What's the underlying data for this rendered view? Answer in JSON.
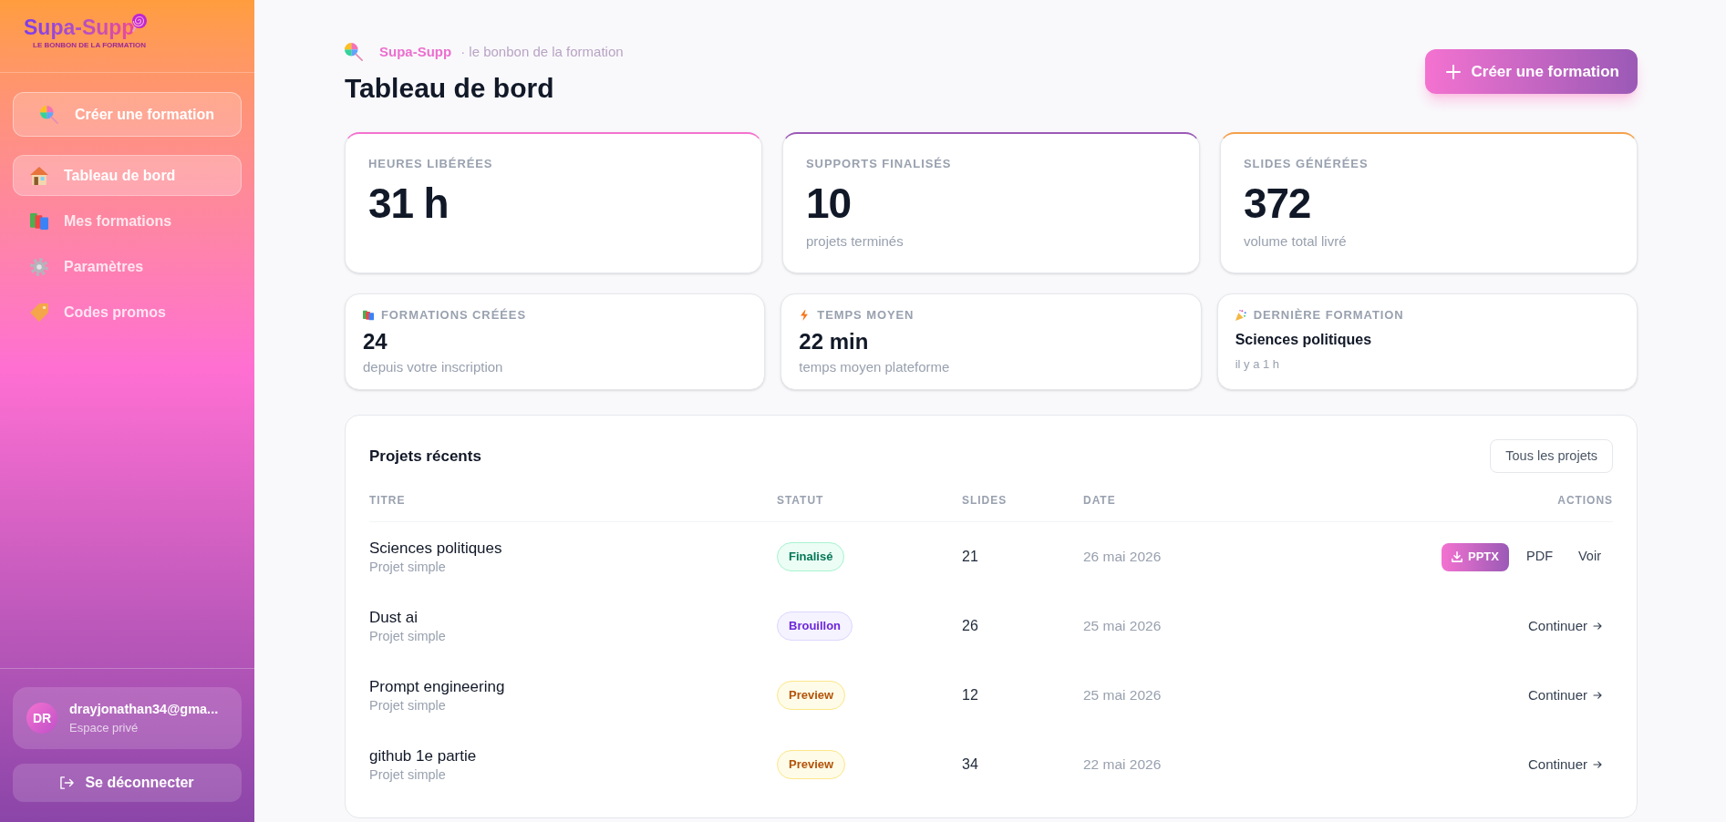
{
  "sidebar": {
    "logo": {
      "name": "Supa-Supp",
      "tagline": "LE BONBON DE LA FORMATION"
    },
    "create_button": "Créer une formation",
    "nav": [
      {
        "label": "Tableau de bord",
        "selected": true
      },
      {
        "label": "Mes formations",
        "selected": false
      },
      {
        "label": "Paramètres",
        "selected": false
      },
      {
        "label": "Codes promos",
        "selected": false
      }
    ],
    "user": {
      "initials": "DR",
      "email": "drayjonathan34@gma...",
      "space": "Espace privé"
    },
    "logout_button": "Se déconnecter"
  },
  "header": {
    "brand": "Supa-Supp",
    "tagline": "· le bonbon de la formation",
    "title": "Tableau de bord",
    "create_button": "Créer une formation"
  },
  "stats": [
    {
      "label": "HEURES LIBÉRÉES",
      "value": "31 h",
      "color": "#f472d0"
    },
    {
      "label": "SUPPORTS FINALISÉS",
      "value": "10",
      "note": "projets terminés",
      "color": "#9b59b6"
    },
    {
      "label": "SLIDES GÉNÉRÉES",
      "value": "372",
      "note": "volume total livré",
      "color": "#f5a04a"
    }
  ],
  "highlights": [
    {
      "kind": "metric",
      "label": "FORMATIONS CRÉÉES",
      "value": "24",
      "note": "depuis votre inscription"
    },
    {
      "kind": "metric",
      "label": "TEMPS MOYEN",
      "value": "22 min",
      "note": "temps moyen plateforme"
    },
    {
      "kind": "latest",
      "label": "DERNIÈRE FORMATION",
      "value": "Sciences politiques",
      "note": "il y a 1 h"
    }
  ],
  "projects": {
    "title": "Projets récents",
    "all_button": "Tous les projets",
    "columns": [
      "TITRE",
      "STATUT",
      "SLIDES",
      "DATE",
      "ACTIONS"
    ],
    "rows": [
      {
        "title": "Sciences politiques",
        "type": "Projet simple",
        "status": {
          "label": "Finalisé",
          "kind": "done"
        },
        "slides": "21",
        "date": "26 mai 2026",
        "actions": [
          {
            "kind": "download",
            "label": "PPTX"
          },
          {
            "kind": "link",
            "label": "PDF"
          },
          {
            "kind": "link",
            "label": "Voir"
          }
        ]
      },
      {
        "title": "Dust ai",
        "type": "Projet simple",
        "status": {
          "label": "Brouillon",
          "kind": "draft"
        },
        "slides": "26",
        "date": "25 mai 2026",
        "actions": [
          {
            "kind": "continue",
            "label": "Continuer"
          }
        ]
      },
      {
        "title": "Prompt engineering",
        "type": "Projet simple",
        "status": {
          "label": "Preview",
          "kind": "preview"
        },
        "slides": "12",
        "date": "25 mai 2026",
        "actions": [
          {
            "kind": "continue",
            "label": "Continuer"
          }
        ]
      },
      {
        "title": "github 1e partie",
        "type": "Projet simple",
        "status": {
          "label": "Preview",
          "kind": "preview"
        },
        "slides": "34",
        "date": "22 mai 2026",
        "actions": [
          {
            "kind": "continue",
            "label": "Continuer"
          }
        ]
      }
    ]
  }
}
